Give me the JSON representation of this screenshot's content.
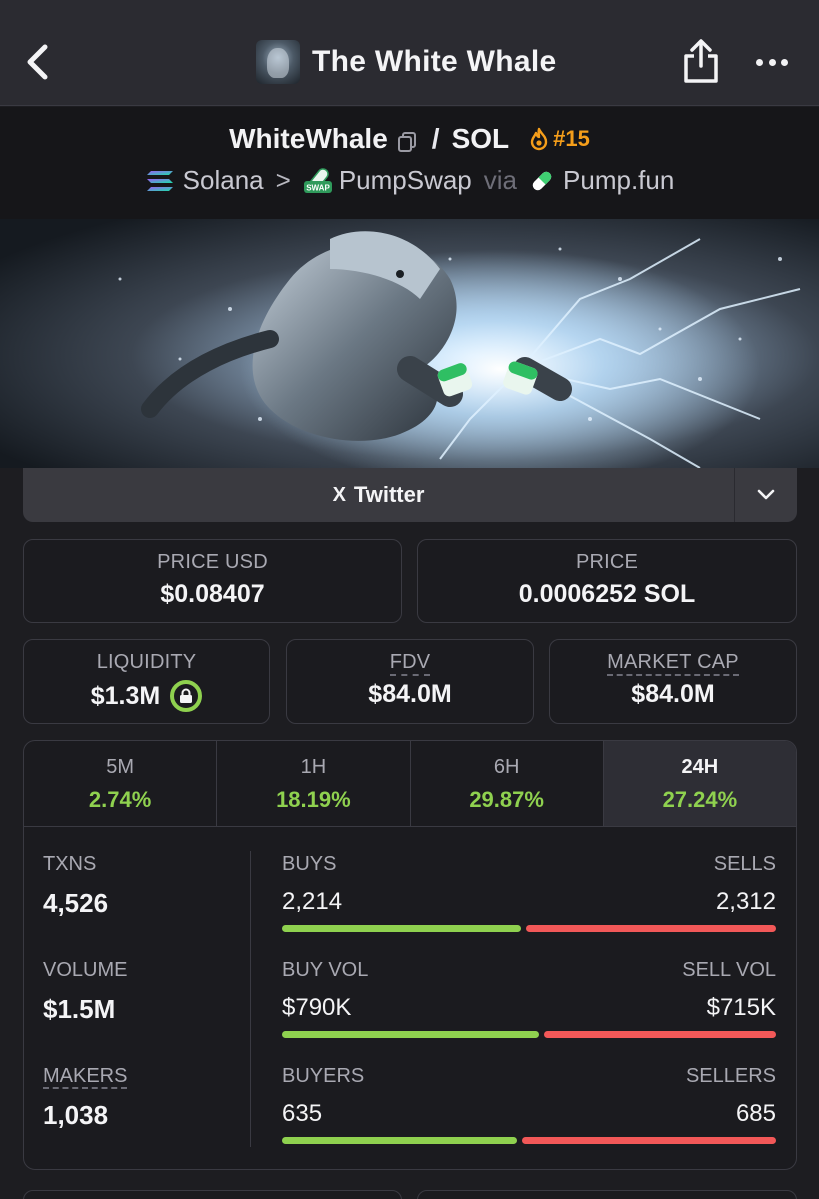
{
  "nav": {
    "title": "The White Whale"
  },
  "pair": {
    "base": "WhiteWhale",
    "separator": "/",
    "quote": "SOL",
    "rank": "#15",
    "chain": "Solana",
    "chevron": ">",
    "dex": "PumpSwap",
    "via": "via",
    "launchpad": "Pump.fun",
    "swap_badge": "SWAP"
  },
  "links": {
    "twitter_icon": "X",
    "twitter_label": "Twitter"
  },
  "stats": {
    "price_usd_label": "PRICE USD",
    "price_usd": "$0.08407",
    "price_label": "PRICE",
    "price": "0.0006252 SOL",
    "liquidity_label": "LIQUIDITY",
    "liquidity": "$1.3M",
    "fdv_label": "FDV",
    "fdv": "$84.0M",
    "mcap_label": "MARKET CAP",
    "mcap": "$84.0M"
  },
  "timeframes": [
    {
      "label": "5M",
      "change": "2.74%"
    },
    {
      "label": "1H",
      "change": "18.19%"
    },
    {
      "label": "6H",
      "change": "29.87%"
    },
    {
      "label": "24H",
      "change": "27.24%",
      "active": true
    }
  ],
  "activity": {
    "txns_label": "TXNS",
    "txns": "4,526",
    "volume_label": "VOLUME",
    "volume": "$1.5M",
    "makers_label": "MAKERS",
    "makers": "1,038",
    "buys_label": "BUYS",
    "buys": "2,214",
    "sells_label": "SELLS",
    "sells": "2,312",
    "buys_share": 0.489,
    "buy_vol_label": "BUY VOL",
    "buy_vol": "$790K",
    "sell_vol_label": "SELL VOL",
    "sell_vol": "$715K",
    "buy_vol_share": 0.525,
    "buyers_label": "BUYERS",
    "buyers": "635",
    "sellers_label": "SELLERS",
    "sellers": "685",
    "buyers_share": 0.481
  },
  "colors": {
    "positive": "#8fd14f",
    "negative": "#f25858",
    "rank": "#f59e1a",
    "background": "#1d1d21"
  },
  "icons": [
    "back-chevron-icon",
    "share-icon",
    "more-dots-icon",
    "copy-icon",
    "flame-icon",
    "solana-icon",
    "pumpswap-icon",
    "pill-icon",
    "x-logo-icon",
    "chevron-down-icon",
    "lock-icon"
  ]
}
